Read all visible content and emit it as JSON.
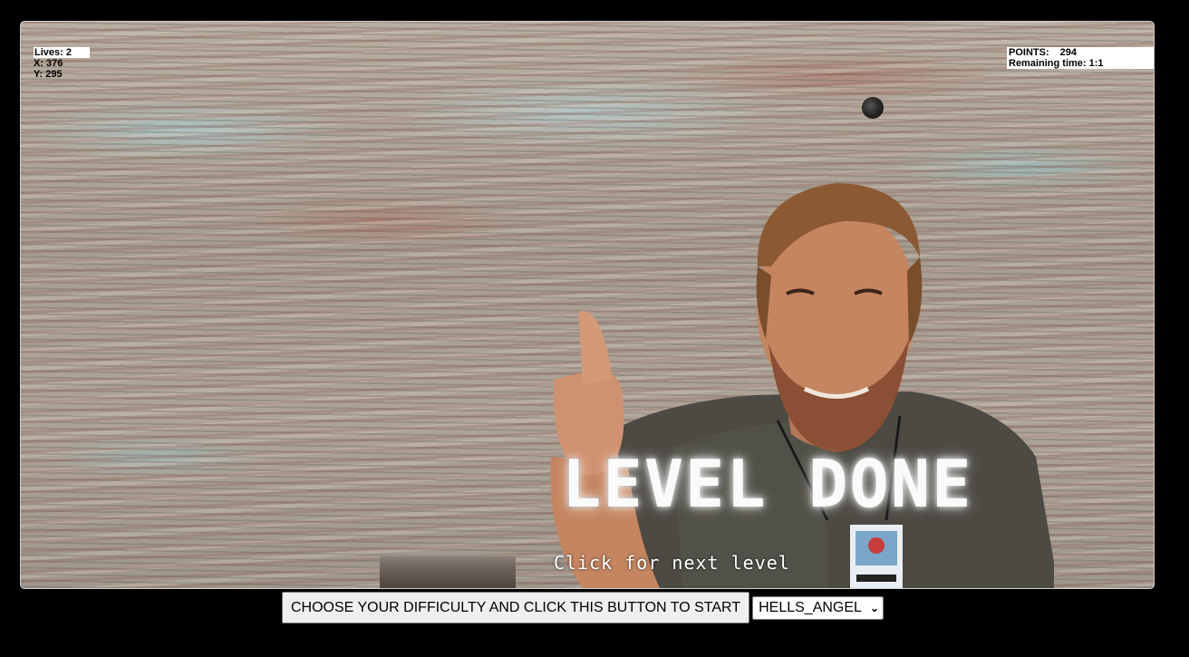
{
  "hud": {
    "lives": "Lives: 2",
    "x": "X: 376",
    "y": "Y: 295",
    "points_label": "POINTS:",
    "points_value": "294",
    "remaining_time": "Remaining time: 1:1"
  },
  "overlay": {
    "title": "LEVEL DONE",
    "subtitle": "Click for next level"
  },
  "controls": {
    "start_label": "CHOOSE YOUR DIFFICULTY AND CLICK THIS BUTTON TO START",
    "difficulty_selected": "HELLS_ANGEL",
    "chevron_icon": "chevron-down-icon"
  },
  "colors": {
    "page_background": "#000000",
    "overlay_text": "#fafafa"
  }
}
